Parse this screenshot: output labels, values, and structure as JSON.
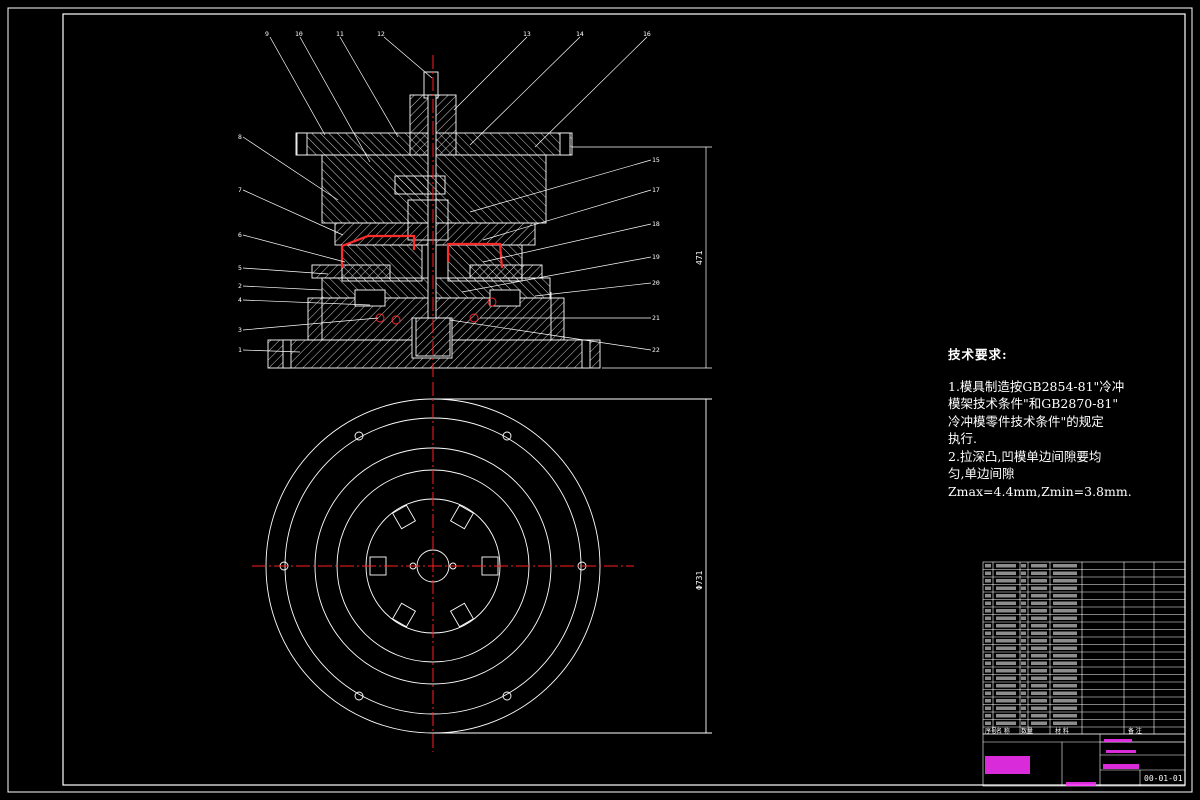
{
  "drawing": {
    "dim_height": "471",
    "dim_diameter": "Φ731",
    "part_labels": [
      "1",
      "2",
      "3",
      "4",
      "5",
      "6",
      "7",
      "8",
      "9",
      "10",
      "11",
      "12",
      "13",
      "14",
      "16",
      "15",
      "17",
      "18",
      "19",
      "20",
      "21",
      "22"
    ],
    "colors": {
      "background": "#000000",
      "lines": "#ffffff",
      "center": "#ff2020",
      "highlight": "#ff2a2a",
      "title_magenta": "#ff33ff"
    }
  },
  "tech_req": {
    "title": "技术要求:",
    "line1": "1.模具制造按GB2854-81\"冷冲",
    "line2": "模架技术条件\"和GB2870-81\"",
    "line3": "冷冲模零件技术条件\"的规定",
    "line4": "执行.",
    "line5": "2.拉深凸,凹模单边间隙要均",
    "line6": "匀,单边间隙",
    "line7": "Zmax=4.4mm,Zmin=3.8mm."
  },
  "title_block": {
    "drawing_number": "00-01-01",
    "header_row": [
      "序号",
      "名 称",
      "数量",
      "材 料",
      "备 注"
    ]
  }
}
